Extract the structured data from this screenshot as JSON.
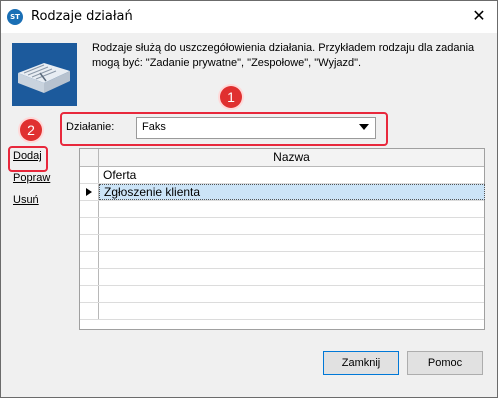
{
  "window": {
    "title": "Rodzaje działań",
    "close_glyph": "✕"
  },
  "description": "Rodzaje służą do uszczegółowienia działania. Przykładem rodzaju dla zadania mogą być: \"Zadanie prywatne\", \"Zespołowe\", \"Wyjazd\".",
  "callouts": {
    "one": "1",
    "two": "2"
  },
  "field": {
    "label": "Działanie:",
    "value": "Faks"
  },
  "side_links": {
    "add": "Dodaj",
    "edit": "Popraw",
    "remove": "Usuń"
  },
  "grid": {
    "column_name": "Nazwa",
    "rows": [
      "Oferta",
      "Zgłoszenie klienta",
      "",
      "",
      "",
      "",
      "",
      "",
      "",
      ""
    ],
    "selected_index": 1
  },
  "buttons": {
    "close": "Zamknij",
    "help": "Pomoc"
  },
  "colors": {
    "callout": "#e03030",
    "selection": "#cce4f7",
    "accent": "#0078d7"
  }
}
